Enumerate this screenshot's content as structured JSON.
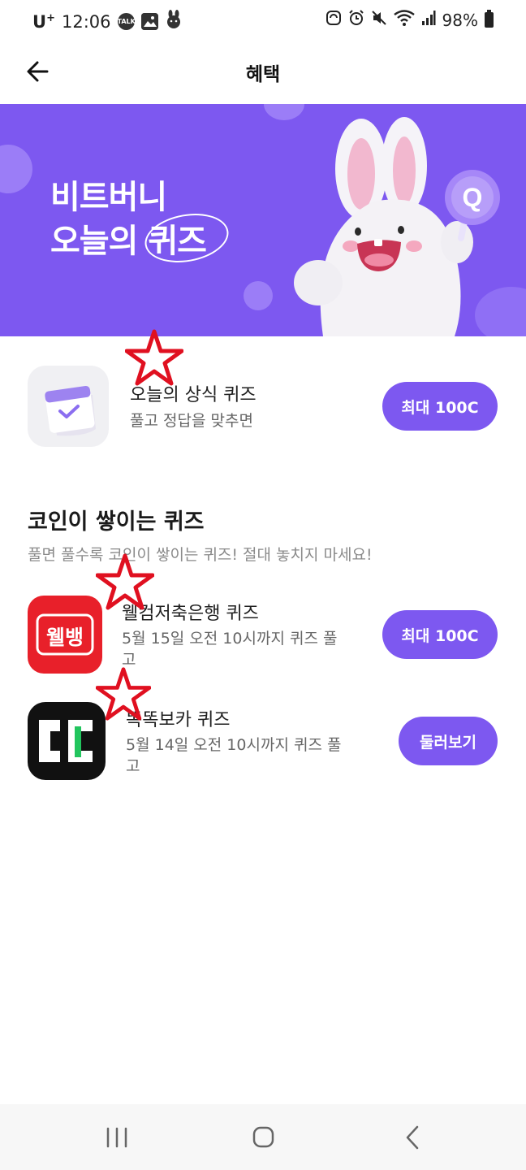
{
  "status_bar": {
    "carrier": "U",
    "carrier_sup": "+",
    "time": "12:06",
    "battery": "98%",
    "left_icons": [
      "talk-icon",
      "gallery-icon",
      "rabbit-app-icon"
    ],
    "right_icons": [
      "sync-icon",
      "alarm-icon",
      "mute-icon",
      "wifi-icon",
      "signal-icon",
      "battery-icon"
    ]
  },
  "header": {
    "title": "혜택"
  },
  "banner": {
    "line1": "비트버니",
    "line2": "오늘의 퀴즈",
    "badge": "Q"
  },
  "daily_quiz": {
    "title": "오늘의 상식 퀴즈",
    "subtitle": "풀고 정답을 맞추면",
    "button": "최대 100C"
  },
  "section": {
    "title": "코인이 쌓이는 퀴즈",
    "subtitle": "풀면 풀수록 코인이 쌓이는 퀴즈! 절대 놓치지 마세요!"
  },
  "quizzes": [
    {
      "title": "웰컴저축은행 퀴즈",
      "subtitle_line1": "5월 15일 오전 10시까지 퀴즈 풀",
      "subtitle_line2": "고",
      "button": "최대 100C",
      "icon_text": "웰뱅"
    },
    {
      "title": "똑똑보카 퀴즈",
      "subtitle_line1": "5월 14일 오전 10시까지 퀴즈 풀",
      "subtitle_line2": "고",
      "button": "둘러보기"
    }
  ],
  "colors": {
    "accent": "#7d58f0",
    "star_red": "#e01020",
    "welcome_red": "#e8202a",
    "vocab_green": "#22c55e"
  }
}
